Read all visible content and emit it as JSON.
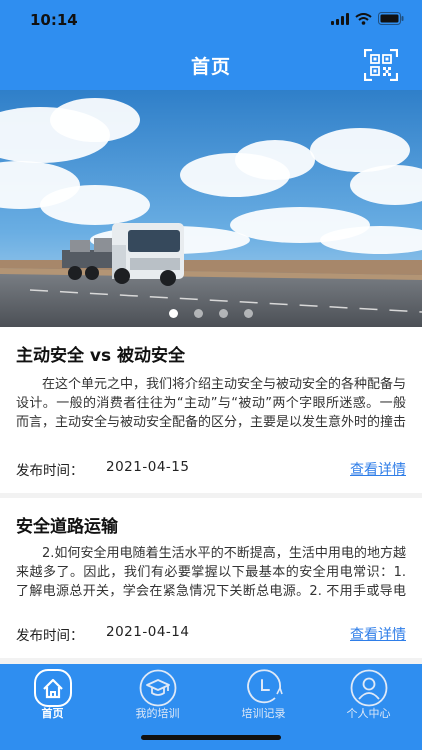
{
  "status_bar": {
    "time": "10:14"
  },
  "header": {
    "title": "首页",
    "scan_icon": "qr-scan-icon"
  },
  "banner": {
    "slides": 4,
    "active_slide": 1
  },
  "articles": [
    {
      "title": "主动安全 vs 被动安全",
      "excerpt": "在这个单元之中，我们将介绍主动安全与被动安全的各种配备与设计。一般的消费者往往为“主动”与“被动”两个字眼所迷惑。一般而言，主动安全与被动安全配备的区分，主要是以发生意外时的撞击做为区分。主",
      "publish_label": "发布时间：",
      "publish_date": "2021-04-15",
      "detail_label": "查看详情"
    },
    {
      "title": "安全道路运输",
      "excerpt": "2.如何安全用电随着生活水平的不断提高，生活中用电的地方越来越多了。因此，我们有必要掌握以下最基本的安全用电常识：1. 了解电源总开关，学会在紧急情况下关断总电源。2. 不用手或导电物（如铁丝、钉",
      "publish_label": "发布时间：",
      "publish_date": "2021-04-14",
      "detail_label": "查看详情"
    }
  ],
  "tabs": [
    {
      "label": "首页",
      "icon": "home-icon",
      "active": true
    },
    {
      "label": "我的培训",
      "icon": "graduation-cap-icon",
      "active": false
    },
    {
      "label": "培训记录",
      "icon": "clock-icon",
      "active": false
    },
    {
      "label": "个人中心",
      "icon": "user-icon",
      "active": false
    }
  ],
  "colors": {
    "primary": "#2f8ef0",
    "link": "#2f7ee8"
  }
}
